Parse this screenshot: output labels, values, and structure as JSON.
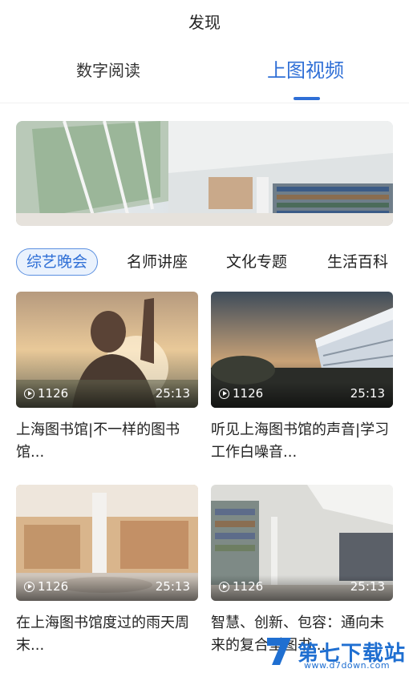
{
  "header": {
    "title": "发现"
  },
  "tabs": [
    {
      "label": "数字阅读",
      "active": false
    },
    {
      "label": "上图视频",
      "active": true
    }
  ],
  "categories": [
    "综艺晚会",
    "名师讲座",
    "文化专题",
    "生活百科"
  ],
  "videos": [
    {
      "title": "上海图书馆|不一样的图书馆...",
      "views": "1126",
      "duration": "25:13"
    },
    {
      "title": "听见上海图书馆的声音|学习工作白噪音...",
      "views": "1126",
      "duration": "25:13"
    },
    {
      "title": "在上海图书馆度过的雨天周末...",
      "views": "1126",
      "duration": "25:13"
    },
    {
      "title": "智慧、创新、包容：通向未来的复合型图书...",
      "views": "1126",
      "duration": "25:13"
    }
  ],
  "watermark": {
    "text": "第七下载站",
    "domain": "www.d7down.com"
  },
  "colors": {
    "accent": "#2f6fd6",
    "active_bg": "#eaf2fd"
  }
}
